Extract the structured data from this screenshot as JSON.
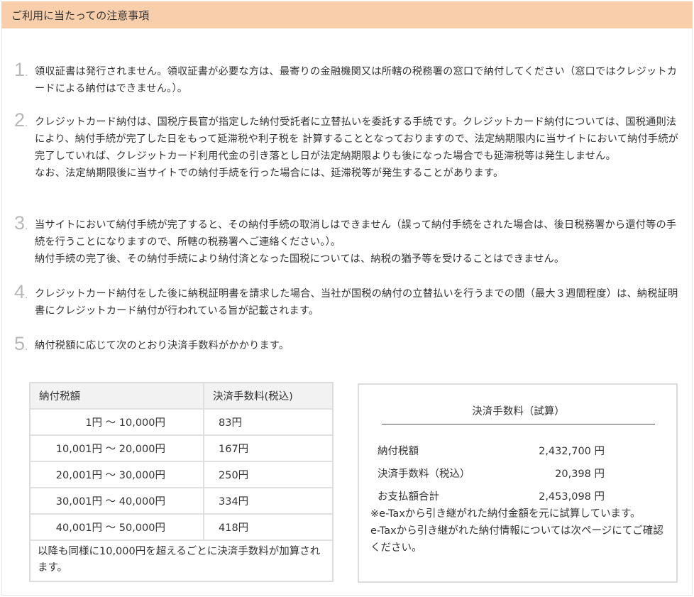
{
  "header": {
    "title": "ご利用に当たっての注意事項"
  },
  "notes": [
    {
      "num": "1",
      "paragraphs": [
        "領収証書は発行されません。領収証書が必要な方は、最寄りの金融機関又は所轄の税務署の窓口で納付してください（窓口ではクレジットカードによる納付はできません。）。"
      ]
    },
    {
      "num": "2",
      "paragraphs": [
        "クレジットカード納付は、国税庁長官が指定した納付受託者に立替払いを委託する手続です。クレジットカード納付については、国税通則法により、納付手続が完了した日をもって延滞税や利子税を 計算することとなっておりますので、法定納期限内に当サイトにおいて納付手続が完了していれば、クレジットカード利用代金の引き落とし日が法定納期限よりも後になった場合でも延滞税等は発生しません。",
        "なお、法定納期限後に当サイトでの納付手続を行った場合には、延滞税等が発生することがあります。"
      ]
    },
    {
      "num": "3",
      "paragraphs": [
        "当サイトにおいて納付手続が完了すると、その納付手続の取消しはできません（誤って納付手続をされた場合は、後日税務署から還付等の手続を行うことになりますので、所轄の税務署へご連絡ください。）。",
        "納付手続の完了後、その納付手続により納付済となった国税については、納税の猶予等を受けることはできません。"
      ]
    },
    {
      "num": "4",
      "paragraphs": [
        "クレジットカード納付をした後に納税証明書を請求した場合、当社が国税の納付の立替払いを行うまでの間（最大３週間程度）は、納税証明書にクレジットカード納付が行われている旨が記載されます。"
      ]
    },
    {
      "num": "5",
      "paragraphs": [
        "納付税額に応じて次のとおり決済手数料がかかります。"
      ]
    }
  ],
  "fee_table": {
    "headers": [
      "納付税額",
      "決済手数料(税込)"
    ],
    "rows": [
      {
        "range": "1円 ～ 10,000円",
        "fee": "83円"
      },
      {
        "range": "10,001円 ～ 20,000円",
        "fee": "167円"
      },
      {
        "range": "20,001円 ～ 30,000円",
        "fee": "250円"
      },
      {
        "range": "30,001円 ～ 40,000円",
        "fee": "334円"
      },
      {
        "range": "40,001円 ～ 50,000円",
        "fee": "418円"
      }
    ],
    "note": "以降も同様に10,000円を超えるごとに決済手数料が加算されます。"
  },
  "calc": {
    "title": "決済手数料（試算）",
    "rows": [
      {
        "label": "納付税額",
        "value": "2,432,700 円"
      },
      {
        "label": "決済手数料（税込）",
        "value": "20,398 円"
      },
      {
        "label": "お支払額合計",
        "value": "2,453,098 円"
      }
    ],
    "note1": "※e-Taxから引き継がれた納付金額を元に試算しています。",
    "note2": "e-Taxから引き継がれた納付情報については次ページにてご確認ください。"
  }
}
